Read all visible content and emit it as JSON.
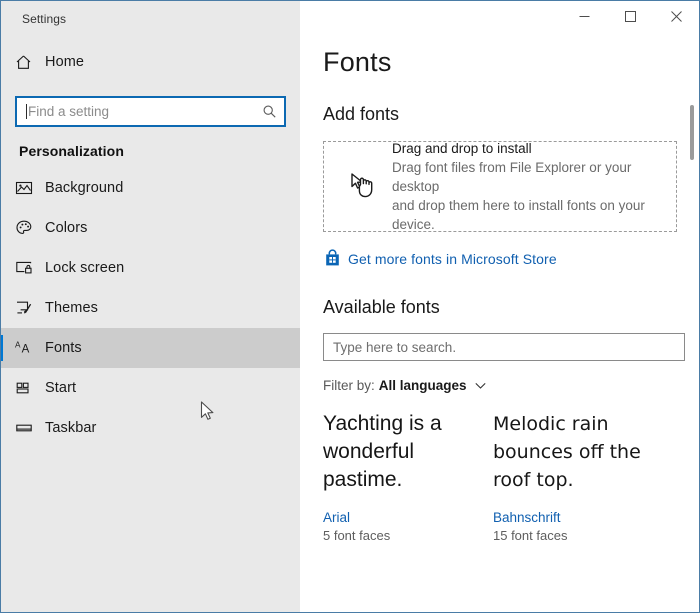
{
  "window": {
    "app_title": "Settings",
    "border_color": "#4a7ca6",
    "controls": {
      "minimize_label": "Minimize",
      "maximize_label": "Maximize",
      "close_label": "Close"
    }
  },
  "sidebar": {
    "home_label": "Home",
    "home_icon": "home-icon",
    "search": {
      "placeholder": "Find a setting",
      "value": "",
      "icon": "search-icon"
    },
    "section_header": "Personalization",
    "accent_color": "#0078d4",
    "selected_background": "#cccccc",
    "items": [
      {
        "label": "Background",
        "icon": "image-icon",
        "selected": false
      },
      {
        "label": "Colors",
        "icon": "palette-icon",
        "selected": false
      },
      {
        "label": "Lock screen",
        "icon": "lock-screen-icon",
        "selected": false
      },
      {
        "label": "Themes",
        "icon": "paintbrush-icon",
        "selected": false
      },
      {
        "label": "Fonts",
        "icon": "font-aa-icon",
        "selected": true
      },
      {
        "label": "Start",
        "icon": "start-tiles-icon",
        "selected": false
      },
      {
        "label": "Taskbar",
        "icon": "taskbar-icon",
        "selected": false
      }
    ]
  },
  "main": {
    "page_title": "Fonts",
    "add_fonts": {
      "heading": "Add fonts",
      "drop_icon": "drag-hand-icon",
      "drop_title": "Drag and drop to install",
      "drop_line1": "Drag font files from File Explorer or your desktop",
      "drop_line2": "and drop them here to install fonts on your device.",
      "store_icon": "microsoft-store-icon",
      "store_link": "Get more fonts in Microsoft Store",
      "link_color": "#1160b0"
    },
    "available_fonts": {
      "heading": "Available fonts",
      "search_placeholder": "Type here to search.",
      "search_value": "",
      "filter_label": "Filter by:",
      "filter_value": "All languages",
      "filter_chevron": "chevron-down-icon",
      "cards": [
        {
          "preview": "Yachting is a wonderful pastime.",
          "name": "Arial",
          "faces": "5 font faces"
        },
        {
          "preview": "Melodic rain bounces off the roof top.",
          "name": "Bahnschrift",
          "faces": "15 font faces"
        }
      ]
    }
  }
}
